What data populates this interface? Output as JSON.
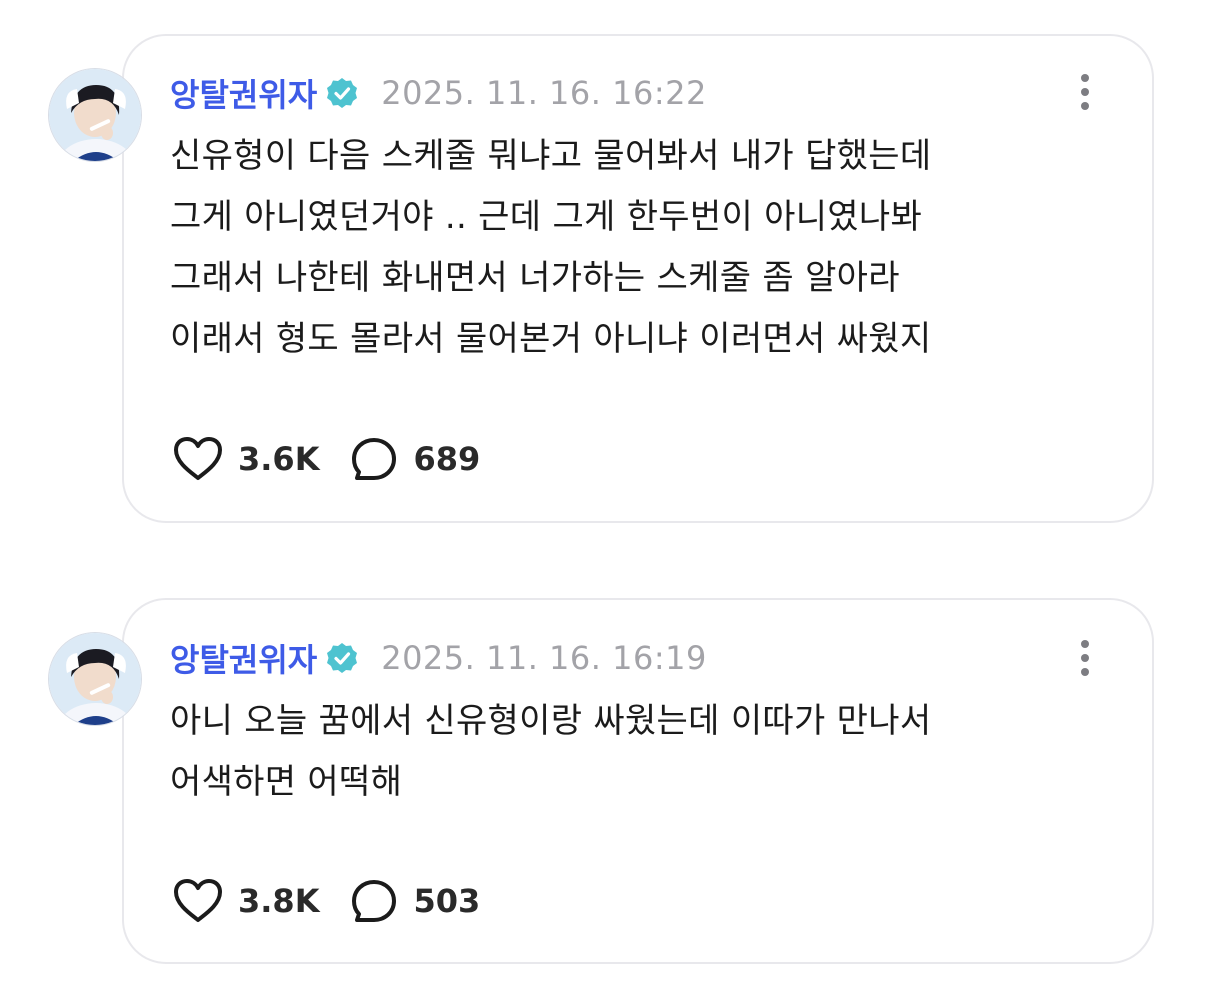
{
  "posts": [
    {
      "author": "앙탈권위자",
      "timestamp": "2025. 11. 16. 16:22",
      "body_lines": [
        "신유형이 다음 스케줄 뭐냐고 물어봐서 내가 답했는데",
        "그게 아니였던거야 .. 근데 그게 한두번이 아니였나봐",
        "그래서 나한테 화내면서 너가하는 스케줄 좀 알아라",
        "이래서 형도 몰라서 물어본거 아니냐 이러면서 싸웠지"
      ],
      "likes": "3.6K",
      "comments": "689"
    },
    {
      "author": "앙탈권위자",
      "timestamp": "2025. 11. 16. 16:19",
      "body_lines": [
        "아니 오늘 꿈에서 신유형이랑 싸웠는데 이따가 만나서",
        "어색하면 어떡해"
      ],
      "likes": "3.8K",
      "comments": "503"
    }
  ],
  "icons": {
    "verified": "verified-badge-icon",
    "more": "more-vertical-icon",
    "like": "heart-icon",
    "comment": "comment-bubble-icon",
    "avatar": "profile-avatar"
  },
  "colors": {
    "author": "#3e5be7",
    "verified_badge": "#4ec3d0",
    "timestamp": "#a3a3a8",
    "text": "#1b1b1b",
    "card_border": "#e8e8ec"
  }
}
